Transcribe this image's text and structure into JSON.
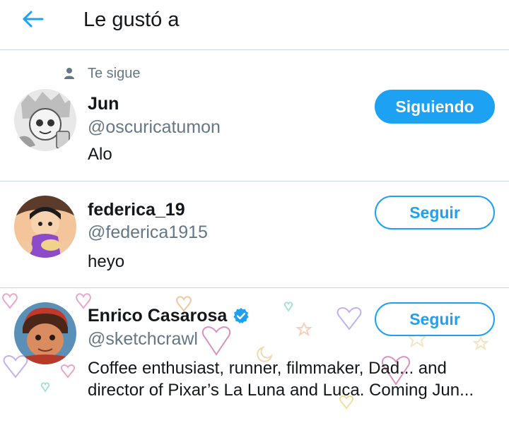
{
  "header": {
    "title": "Le gustó a",
    "back_icon": "arrow-left-icon"
  },
  "colors": {
    "accent": "#1da1f2",
    "secondary_text": "#657786",
    "divider": "#c9d6de"
  },
  "users": [
    {
      "follows_you_label": "Te sigue",
      "name": "Jun",
      "handle": "@oscuricatumon",
      "bio": "Alo",
      "button_label": "Siguiendo",
      "following": true
    },
    {
      "name": "federica_19",
      "handle": "@federica1915",
      "bio": "heyo",
      "button_label": "Seguir",
      "following": false
    },
    {
      "name": "Enrico Casarosa",
      "verified": true,
      "handle": "@sketchcrawl",
      "bio_line1": "Coffee enthusiast, runner, filmmaker, Dad... and",
      "bio_line2": "director of Pixar’s La Luna and Luca. Coming Jun...",
      "button_label": "Seguir",
      "following": false
    }
  ]
}
